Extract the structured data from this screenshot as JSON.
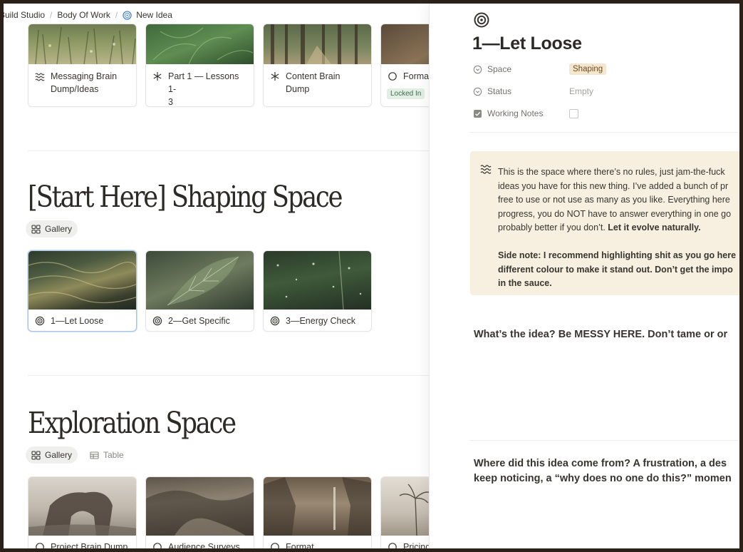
{
  "breadcrumb": {
    "items": [
      "Build Studio",
      "Body Of Work",
      "New Idea"
    ]
  },
  "top_cards": [
    {
      "label": "Messaging Brain Dump/Ideas",
      "line1": "Messaging Brain",
      "line2": "Dump/Ideas",
      "icon": "waves-icon"
    },
    {
      "label": "Part 1 — Lessons 1-3",
      "line1": "Part 1 — Lessons 1-",
      "line2": "3",
      "icon": "asterisk-icon"
    },
    {
      "label": "Content Brain Dump",
      "line1": "Content Brain",
      "line2": "Dump",
      "icon": "asterisk-icon"
    },
    {
      "label": "Format",
      "line1": "Format",
      "tag": "Locked In",
      "icon": "circle-icon"
    }
  ],
  "shaping": {
    "title": "[Start Here] Shaping Space",
    "view_tab": "Gallery",
    "cards": [
      {
        "label": "1—Let Loose",
        "icon": "target-icon"
      },
      {
        "label": "2—Get Specific",
        "icon": "target-icon"
      },
      {
        "label": "3—Energy Check",
        "icon": "target-icon"
      }
    ]
  },
  "exploration": {
    "title": "Exploration Space",
    "view_tabs": [
      "Gallery",
      "Table"
    ],
    "cards": [
      {
        "label": "Project Brain Dump",
        "icon": "circle-icon"
      },
      {
        "label": "Audience Surveys",
        "icon": "circle-icon"
      },
      {
        "label": "Format",
        "icon": "circle-icon"
      },
      {
        "label": "Pricing",
        "icon": "circle-icon"
      }
    ]
  },
  "detail": {
    "title": "1—Let Loose",
    "properties": [
      {
        "name": "Space",
        "value": "Shaping"
      },
      {
        "name": "Status",
        "value": "Empty"
      },
      {
        "name": "Working Notes",
        "value": ""
      }
    ],
    "callout": {
      "lines": [
        "This is the space where there’s no rules, just jam-the-fuck",
        "ideas you have for this new thing. I’ve added a bunch of pr",
        "free to use or not use as many as you like. Everything here",
        "progress, you do NOT have to answer everything in one go",
        "probably better if you don’t.",
        "Let it evolve naturally."
      ],
      "bold_lines": [
        "Side note: I recommend highlighting shit as you go here",
        "different colour to make it stand out. Don’t get the impo",
        "in the sauce."
      ]
    },
    "question1": "What’s the idea? Be MESSY HERE. Don’t tame or or",
    "question2_line1": "Where did this idea come from? A frustration, a des",
    "question2_line2": "keep noticing, a “why does no one do this?” momen"
  },
  "colors": {
    "accent_blue": "#a9c4e6",
    "callout_bg": "#f7f0e1",
    "shaping_tag": "#f4e6cf",
    "locked_tag": "#e1efe5"
  }
}
